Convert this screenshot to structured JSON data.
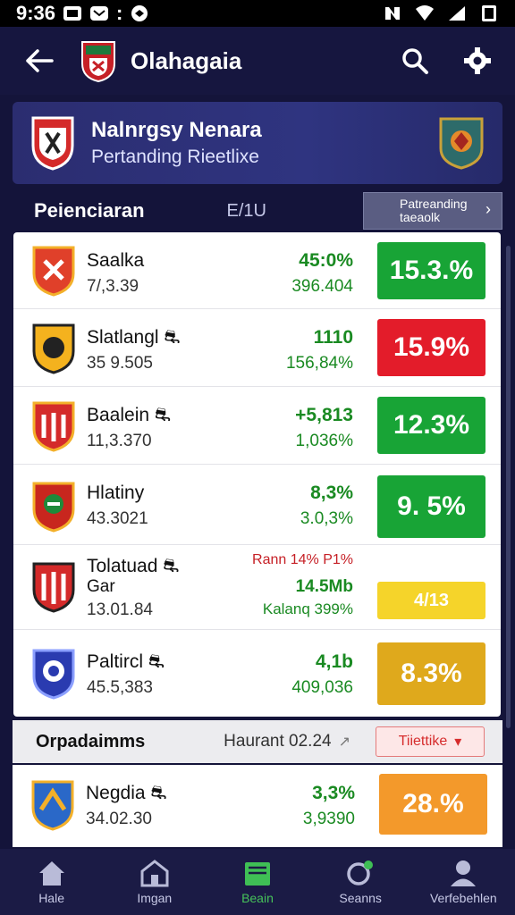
{
  "status": {
    "time": "9:36"
  },
  "app": {
    "title": "Olahagaia"
  },
  "banner": {
    "title": "Nalnrgsy Nenara",
    "subtitle": "Pertanding Rieetlixe"
  },
  "section": {
    "name": "Peienciaran",
    "mid": "E/1U",
    "trend_line1": "Patreanding",
    "trend_line2": "taeaolk"
  },
  "rows": [
    {
      "team": "Saalka",
      "sub": "7/,3.39",
      "v1": "45:0%",
      "v2": "396.404",
      "pill": "15.3.%",
      "color": "green"
    },
    {
      "team": "Slatlangl ⛐",
      "sub": "35 9.505",
      "v1": "1110",
      "v2": "156,84%",
      "pill": "15.9%",
      "color": "red"
    },
    {
      "team": "Baalein ⛐",
      "sub": "11,3.370",
      "v1": "+5,813",
      "v2": "1,036%",
      "pill": "12.3%",
      "color": "green"
    },
    {
      "team": "Hlatiny",
      "sub": "43.3021",
      "v1": "8,3%",
      "v2": "3.0,3%",
      "pill": "9. 5%",
      "color": "green"
    },
    {
      "team": "Tolatuad ⛐",
      "team2": "Gar",
      "sub": "13.01.84",
      "v1": "Rann 14% P1%",
      "v2": "14.5Mb",
      "v3": "Kalanq 399%",
      "pill": "4/13",
      "color": "yellow"
    },
    {
      "team": "Paltircl ⛐",
      "sub": "45.5,383",
      "v1": "4,1b",
      "v2": "409,036",
      "pill": "8.3%",
      "color": "gold"
    }
  ],
  "section2": {
    "name": "Orpadaimms",
    "date": "Haurant 02.24",
    "pill": "Tiiettike"
  },
  "row2": {
    "team": "Negdia ⛐",
    "sub": "34.02.30",
    "v1": "3,3%",
    "v2": "3,9390",
    "pill": "28.%",
    "color": "orange"
  },
  "nav": [
    {
      "label": "Hale",
      "icon": "home-icon"
    },
    {
      "label": "Imgan",
      "icon": "stadium-icon"
    },
    {
      "label": "Beain",
      "icon": "stats-icon"
    },
    {
      "label": "Seanns",
      "icon": "refresh-icon"
    },
    {
      "label": "Verfebehlen",
      "icon": "profile-icon"
    }
  ]
}
